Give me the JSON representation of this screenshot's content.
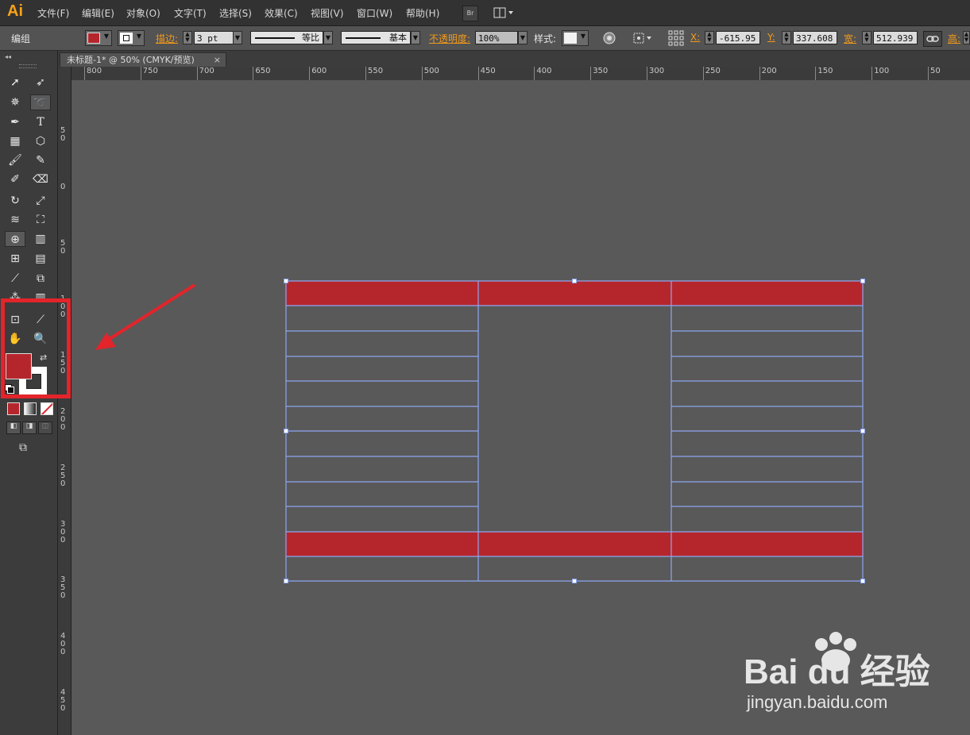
{
  "app": {
    "logo": "Ai"
  },
  "menu": [
    "文件(F)",
    "编辑(E)",
    "对象(O)",
    "文字(T)",
    "选择(S)",
    "效果(C)",
    "视图(V)",
    "窗口(W)",
    "帮助(H)"
  ],
  "menubar_buttons": {
    "bridge": "Br",
    "arrange": "workspace-icon"
  },
  "control": {
    "selection_type": "编组",
    "fill_color": "#b5262c",
    "stroke_label": "描边:",
    "stroke_weight": "3 pt",
    "stroke_profile": "等比",
    "brush": "基本",
    "opacity_label": "不透明度:",
    "opacity": "100%",
    "style_label": "样式:",
    "x_label": "X:",
    "x_value": "-615.95",
    "y_label": "Y:",
    "y_value": "337.608",
    "w_label": "宽:",
    "w_value": "512.939",
    "h_label": "高:"
  },
  "document": {
    "tab_title": "未标题-1* @ 50% (CMYK/预览)",
    "close": "×"
  },
  "ruler": {
    "horizontal": [
      "800",
      "750",
      "700",
      "650",
      "600",
      "550",
      "500",
      "450",
      "400",
      "350",
      "300",
      "250",
      "200",
      "150",
      "100",
      "50"
    ],
    "vertical": [
      "50",
      "0",
      "50",
      "100",
      "150",
      "200",
      "250",
      "300",
      "350",
      "400",
      "450"
    ]
  },
  "tools": {
    "fill_color": "#b5262c",
    "stroke_color": "#ffffff"
  },
  "table": {
    "header_color": "#b5262c",
    "grid_color": "#8ea6f0"
  },
  "watermark": {
    "logo": "Bai du 经验",
    "site": "jingyan.baidu.com"
  },
  "colors": {
    "accent": "#f29a1a",
    "annotation": "#e3242b"
  }
}
